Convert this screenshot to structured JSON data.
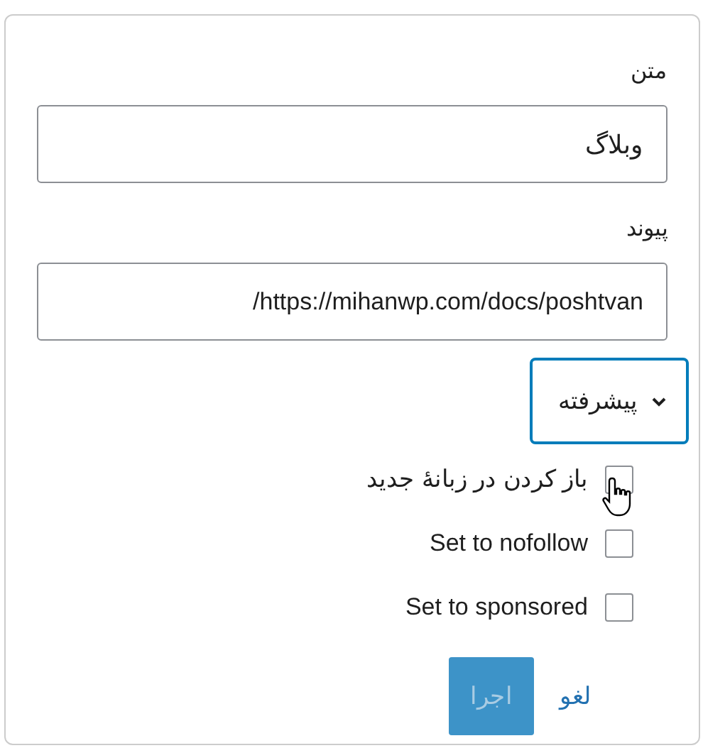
{
  "fields": [
    {
      "label": "متن",
      "value": "وبلاگ"
    },
    {
      "label": "پیوند",
      "value": "https://mihanwp.com/docs/poshtvan/"
    }
  ],
  "advanced": {
    "label": "پیشرفته",
    "expanded": true
  },
  "options": [
    {
      "label": "باز کردن در زبانهٔ جدید",
      "checked": false,
      "hovered": true
    },
    {
      "label": "Set to nofollow",
      "checked": false,
      "hovered": false
    },
    {
      "label": "Set to sponsored",
      "checked": false,
      "hovered": false
    }
  ],
  "actions": {
    "cancel": "لغو",
    "apply": {
      "label": "اجرا",
      "disabled": true
    }
  }
}
